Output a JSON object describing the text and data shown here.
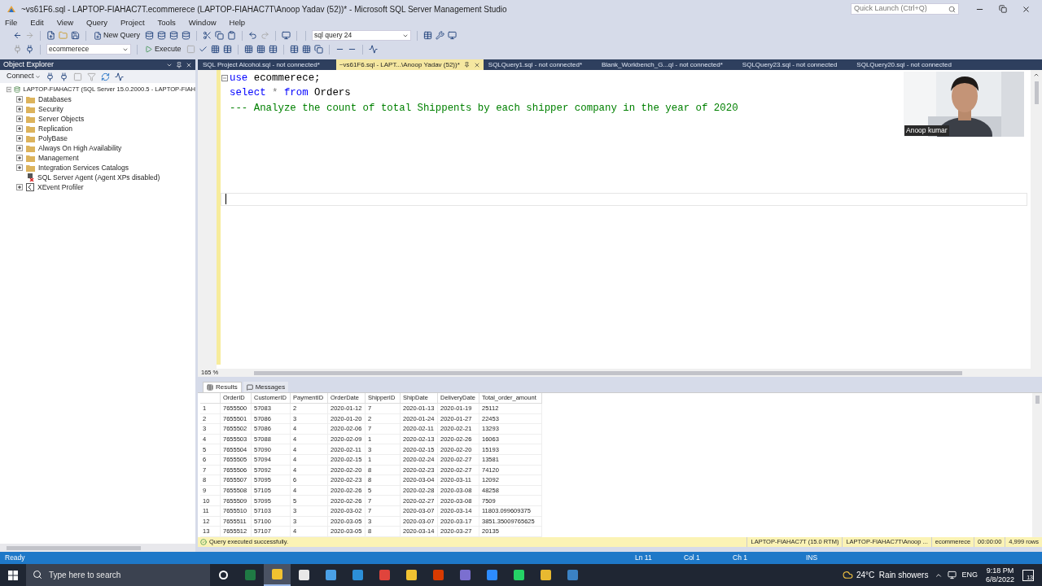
{
  "window": {
    "title": "~vs61F6.sql - LAPTOP-FIAHAC7T.ecommerece (LAPTOP-FIAHAC7T\\Anoop Yadav (52))* - Microsoft SQL Server Management Studio"
  },
  "quick_launch": {
    "placeholder": "Quick Launch (Ctrl+Q)"
  },
  "menu": [
    "File",
    "Edit",
    "View",
    "Query",
    "Project",
    "Tools",
    "Window",
    "Help"
  ],
  "toolbar": {
    "new_query": "New Query",
    "solution_config": "sql query 24",
    "database": "ecommerece",
    "execute": "Execute"
  },
  "object_explorer": {
    "title": "Object Explorer",
    "connect": "Connect",
    "tree": {
      "label": "LAPTOP-FIAHAC7T (SQL Server 15.0.2000.5 - LAPTOP-FIAH",
      "expanded": true,
      "children": [
        {
          "label": "Databases",
          "kind": "folder",
          "expanded": false
        },
        {
          "label": "Security",
          "kind": "folder",
          "expanded": false
        },
        {
          "label": "Server Objects",
          "kind": "folder",
          "expanded": false
        },
        {
          "label": "Replication",
          "kind": "folder",
          "expanded": false
        },
        {
          "label": "PolyBase",
          "kind": "folder",
          "expanded": false
        },
        {
          "label": "Always On High Availability",
          "kind": "folder",
          "expanded": false
        },
        {
          "label": "Management",
          "kind": "folder",
          "expanded": false
        },
        {
          "label": "Integration Services Catalogs",
          "kind": "folder",
          "expanded": false
        },
        {
          "label": "SQL Server Agent (Agent XPs disabled)",
          "kind": "agent",
          "expanded": false
        },
        {
          "label": "XEvent Profiler",
          "kind": "profiler",
          "expanded": false
        }
      ]
    }
  },
  "tabs": [
    {
      "label": "SQL Project  Alcohol.sql - not connected*",
      "selected": false
    },
    {
      "label": "~vs61F6.sql - LAPT...\\Anoop Yadav (52))*",
      "selected": true
    },
    {
      "label": "SQLQuery1.sql - not connected*",
      "selected": false
    },
    {
      "label": "Blank_Workbench_G...ql - not connected*",
      "selected": false
    },
    {
      "label": "SQLQuery23.sql - not connected",
      "selected": false
    },
    {
      "label": "SQLQuery20.sql - not connected",
      "selected": false
    }
  ],
  "editor": {
    "lines": [
      [
        {
          "text": "use",
          "kind": "keyword"
        },
        {
          "text": " ecommerece;",
          "kind": "plain"
        }
      ],
      [
        {
          "text": "select",
          "kind": "keyword"
        },
        {
          "text": " * ",
          "kind": "operator"
        },
        {
          "text": "from",
          "kind": "keyword"
        },
        {
          "text": " Orders",
          "kind": "plain"
        }
      ],
      [
        {
          "text": "--- Analyze the count of total Shippents by each shipper company in the year of 2020",
          "kind": "comment"
        }
      ]
    ],
    "zoom": "165 %"
  },
  "webcam": {
    "kind": "picture",
    "name": "Anoop kumar"
  },
  "results_tabs": [
    {
      "label": "Results",
      "selected": true
    },
    {
      "label": "Messages",
      "selected": false
    }
  ],
  "grid": {
    "columns": [
      "",
      "OrderID",
      "CustomerID",
      "PaymentID",
      "OrderDate",
      "ShipperID",
      "ShipDate",
      "DeliveryDate",
      "Total_order_amount"
    ],
    "rows": [
      [
        "1",
        "7655500",
        "57083",
        "2",
        "2020-01-12",
        "7",
        "2020-01-13",
        "2020-01-19",
        "25112"
      ],
      [
        "2",
        "7655501",
        "57086",
        "3",
        "2020-01-20",
        "2",
        "2020-01-24",
        "2020-01-27",
        "22453"
      ],
      [
        "3",
        "7655502",
        "57086",
        "4",
        "2020-02-06",
        "7",
        "2020-02-11",
        "2020-02-21",
        "13293"
      ],
      [
        "4",
        "7655503",
        "57088",
        "4",
        "2020-02-09",
        "1",
        "2020-02-13",
        "2020-02-26",
        "16063"
      ],
      [
        "5",
        "7655504",
        "57090",
        "4",
        "2020-02-11",
        "3",
        "2020-02-15",
        "2020-02-20",
        "15193"
      ],
      [
        "6",
        "7655505",
        "57094",
        "4",
        "2020-02-15",
        "1",
        "2020-02-24",
        "2020-02-27",
        "13581"
      ],
      [
        "7",
        "7655506",
        "57092",
        "4",
        "2020-02-20",
        "8",
        "2020-02-23",
        "2020-02-27",
        "74120"
      ],
      [
        "8",
        "7655507",
        "57095",
        "6",
        "2020-02-23",
        "8",
        "2020-03-04",
        "2020-03-11",
        "12092"
      ],
      [
        "9",
        "7655508",
        "57105",
        "4",
        "2020-02-26",
        "5",
        "2020-02-28",
        "2020-03-08",
        "48258"
      ],
      [
        "10",
        "7655509",
        "57095",
        "5",
        "2020-02-26",
        "7",
        "2020-02-27",
        "2020-03-08",
        "7509"
      ],
      [
        "11",
        "7655510",
        "57103",
        "3",
        "2020-03-02",
        "7",
        "2020-03-07",
        "2020-03-14",
        "11803.099609375"
      ],
      [
        "12",
        "7655511",
        "57100",
        "3",
        "2020-03-05",
        "3",
        "2020-03-07",
        "2020-03-17",
        "3851.35009765625"
      ],
      [
        "13",
        "7655512",
        "57107",
        "4",
        "2020-03-05",
        "8",
        "2020-03-14",
        "2020-03-27",
        "20135"
      ]
    ]
  },
  "query_status": {
    "message": "Query executed successfully.",
    "segments": [
      "LAPTOP-FIAHAC7T (15.0 RTM)",
      "LAPTOP-FIAHAC7T\\Anoop ...",
      "ecommerece",
      "00:00:00",
      "4,999 rows"
    ]
  },
  "status_bar": {
    "state": "Ready",
    "fields": [
      "Ln 11",
      "Col 1",
      "Ch 1",
      "INS"
    ]
  },
  "taskbar": {
    "search_placeholder": "Type here to search",
    "apps": [
      {
        "kind": "cortana",
        "selected": false
      },
      {
        "kind": "excel",
        "selected": false
      },
      {
        "kind": "notes",
        "selected": true
      },
      {
        "kind": "mail",
        "selected": false
      },
      {
        "kind": "laptop",
        "selected": false
      },
      {
        "kind": "edge",
        "selected": false
      },
      {
        "kind": "gift",
        "selected": false
      },
      {
        "kind": "folder",
        "selected": false
      },
      {
        "kind": "office",
        "selected": false
      },
      {
        "kind": "app",
        "selected": false
      },
      {
        "kind": "zoom",
        "selected": false
      },
      {
        "kind": "whatsapp",
        "selected": false
      },
      {
        "kind": "chrome",
        "selected": false
      },
      {
        "kind": "ssms",
        "selected": false
      }
    ],
    "weather": "24°C  Rain showers",
    "language": "ENG",
    "time": "9:18 PM",
    "date": "6/8/2022",
    "notifications": "13"
  }
}
